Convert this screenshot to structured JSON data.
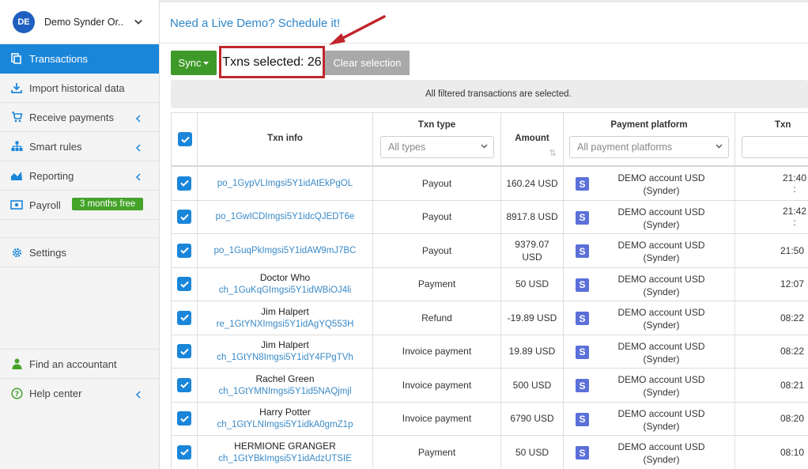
{
  "org": {
    "initials": "DE",
    "name": "Demo Synder Or..."
  },
  "sidebar": {
    "items": [
      {
        "label": "Transactions",
        "icon": "transactions-icon"
      },
      {
        "label": "Import historical data",
        "icon": "download-icon"
      },
      {
        "label": "Receive payments",
        "icon": "cart-icon"
      },
      {
        "label": "Smart rules",
        "icon": "hierarchy-icon"
      },
      {
        "label": "Reporting",
        "icon": "chart-icon"
      },
      {
        "label": "Payroll",
        "icon": "money-icon",
        "badge": "3 months free"
      },
      {
        "label": "Settings",
        "icon": "gear-icon"
      },
      {
        "label": "Find an accountant",
        "icon": "person-icon"
      },
      {
        "label": "Help center",
        "icon": "help-icon"
      }
    ]
  },
  "topbar": {
    "demo_link": "Need a Live Demo? Schedule it!"
  },
  "toolbar": {
    "sync_label": "Sync",
    "selected_text": "Txns selected: 26",
    "clear_label": "Clear selection"
  },
  "notice": "All filtered transactions are selected.",
  "table": {
    "headers": {
      "info": "Txn info",
      "type": "Txn type",
      "type_filter": "All types",
      "amount": "Amount",
      "platform": "Payment platform",
      "platform_filter": "All payment platforms",
      "time": "Txn"
    },
    "rows": [
      {
        "customer": "",
        "id": "po_1GypVLImgsi5Y1idAtEkPgOL",
        "type": "Payout",
        "amount": "160.24 USD",
        "platform": "DEMO account USD (Synder)",
        "time": "21:40 :"
      },
      {
        "customer": "",
        "id": "po_1GwICDImgsi5Y1idcQJEDT6e",
        "type": "Payout",
        "amount": "8917.8 USD",
        "platform": "DEMO account USD (Synder)",
        "time": "21:42 :"
      },
      {
        "customer": "",
        "id": "po_1GuqPkImgsi5Y1idAW9mJ7BC",
        "type": "Payout",
        "amount": "9379.07 USD",
        "platform": "DEMO account USD (Synder)",
        "time": "21:50"
      },
      {
        "customer": "Doctor Who",
        "id": "ch_1GuKqGImgsi5Y1idWBiOJ4li",
        "type": "Payment",
        "amount": "50 USD",
        "platform": "DEMO account USD (Synder)",
        "time": "12:07"
      },
      {
        "customer": "Jim Halpert",
        "id": "re_1GtYNXImgsi5Y1idAgYQ553H",
        "type": "Refund",
        "amount": "-19.89 USD",
        "platform": "DEMO account USD (Synder)",
        "time": "08:22"
      },
      {
        "customer": "Jim Halpert",
        "id": "ch_1GtYN8Imgsi5Y1idY4FPgTVh",
        "type": "Invoice payment",
        "amount": "19.89 USD",
        "platform": "DEMO account USD (Synder)",
        "time": "08:22"
      },
      {
        "customer": "Rachel Green",
        "id": "ch_1GtYMNImgsi5Y1id5NAQjmjl",
        "type": "Invoice payment",
        "amount": "500 USD",
        "platform": "DEMO account USD (Synder)",
        "time": "08:21"
      },
      {
        "customer": "Harry Potter",
        "id": "ch_1GtYLNImgsi5Y1idkA0gmZ1p",
        "type": "Invoice payment",
        "amount": "6790 USD",
        "platform": "DEMO account USD (Synder)",
        "time": "08:20"
      },
      {
        "customer": "HERMIONE GRANGER",
        "id": "ch_1GtYBkImgsi5Y1idAdzUTSIE",
        "type": "Payment",
        "amount": "50 USD",
        "platform": "DEMO account USD (Synder)",
        "time": "08:10"
      }
    ]
  },
  "colors": {
    "accent": "#1a86d9",
    "sync_green": "#3e9a28",
    "highlight_red": "#c0262b",
    "link": "#2f86c9"
  }
}
